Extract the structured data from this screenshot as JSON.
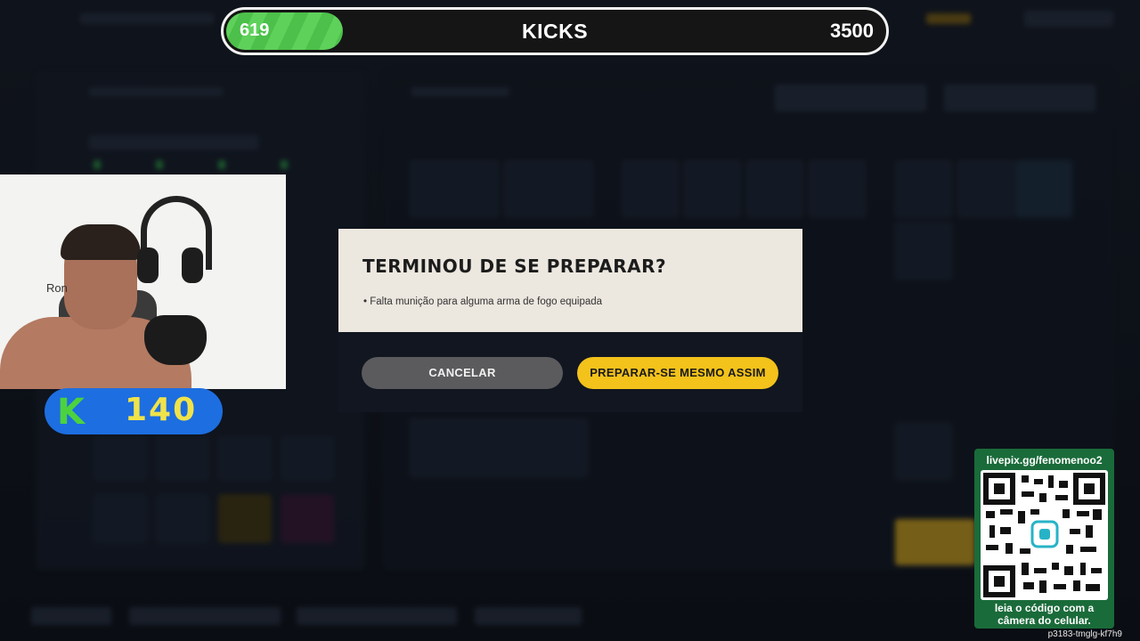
{
  "kicks": {
    "current": "619",
    "label": "KICKS",
    "goal": "3500",
    "progress": 0.177
  },
  "webcam": {
    "overlay_text": "Ron"
  },
  "badge": {
    "letter": "K",
    "value": "140"
  },
  "dialog": {
    "title": "TERMINOU DE SE PREPARAR?",
    "message": "• Falta munição para alguma arma de fogo equipada",
    "cancel_label": "CANCELAR",
    "confirm_label": "PREPARAR-SE MESMO ASSIM"
  },
  "qr": {
    "url": "livepix.gg/fenomenoo2",
    "caption_line1": "leia o código com a",
    "caption_line2": "câmera do celular."
  },
  "stream_id": "p3183-tmglg-kf7h9",
  "colors": {
    "accent_yellow": "#f3c21b",
    "kicks_green": "#5ed15a",
    "badge_blue": "#1d6ee0",
    "qr_green": "#1a6b3a"
  }
}
